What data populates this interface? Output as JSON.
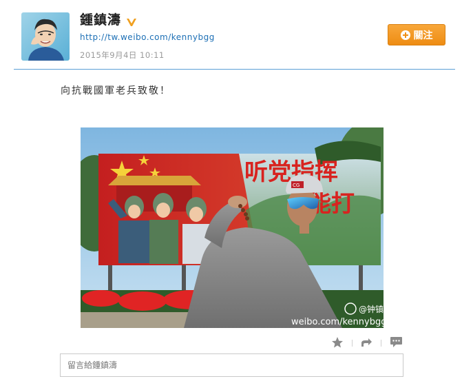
{
  "post": {
    "author_name": "鍾鎮濤",
    "profile_url": "http://tw.weibo.com/kennybgg",
    "timestamp": "2015年9月4日 10:11",
    "follow_label": "關注",
    "text": "向抗戰國軍老兵致敬！"
  },
  "image": {
    "billboard_text_line1": "听党指挥",
    "billboard_text_line2": "能打",
    "watermark_handle": "@钟镇涛",
    "watermark_url": "weibo.com/kennybgg",
    "cap_logo": "CG"
  },
  "actions": {
    "favorite_icon": "star-icon",
    "repost_icon": "repost-icon",
    "comment_icon": "comment-icon"
  },
  "comment_input": {
    "placeholder": "留言給鍾鎮濤"
  },
  "colors": {
    "accent_link": "#1c6fb5",
    "follow_button": "#ee8c13",
    "divider": "#5a9ed6",
    "verified_badge": "#f0a020"
  }
}
